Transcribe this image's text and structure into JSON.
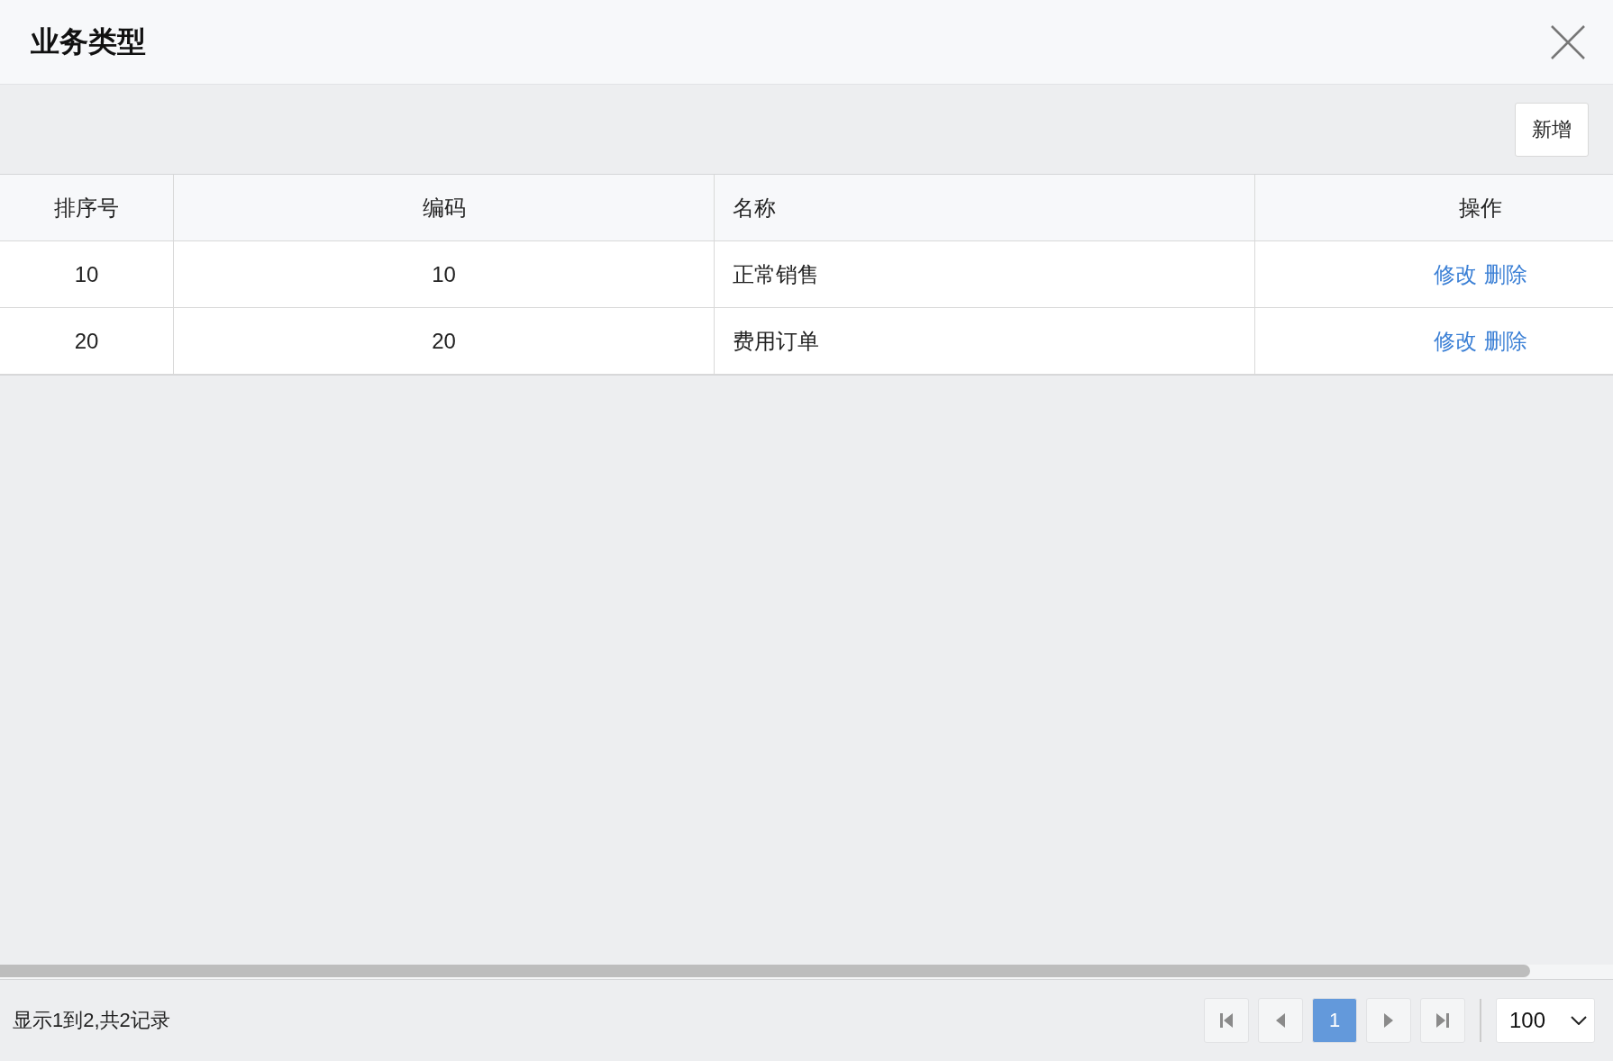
{
  "dialog": {
    "title": "业务类型"
  },
  "toolbar": {
    "buttons": [
      "新增"
    ]
  },
  "table": {
    "columns": [
      "排序号",
      "编码",
      "名称",
      "操作"
    ],
    "rows": [
      {
        "cells": [
          "10",
          "10",
          "正常销售"
        ],
        "actions": [
          "修改",
          "删除"
        ]
      },
      {
        "cells": [
          "20",
          "20",
          "费用订单"
        ],
        "actions": [
          "修改",
          "删除"
        ]
      }
    ]
  },
  "footer": {
    "summary": "显示1到2,共2记录",
    "pages": [
      {
        "label": "1",
        "selected": true
      }
    ],
    "page_size": "100"
  }
}
